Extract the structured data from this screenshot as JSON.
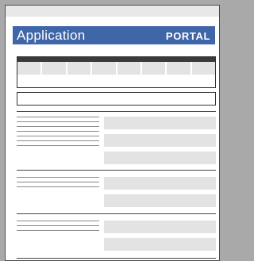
{
  "header": {
    "title": "Application",
    "badge": "PORTAL",
    "background_color": "#3f66a8"
  },
  "table": {
    "columns": 8
  },
  "sections": [
    {
      "text_lines": 7,
      "input_fields": 3
    },
    {
      "text_lines": 3,
      "input_fields": 2
    },
    {
      "text_lines": 3,
      "input_fields": 2
    }
  ]
}
